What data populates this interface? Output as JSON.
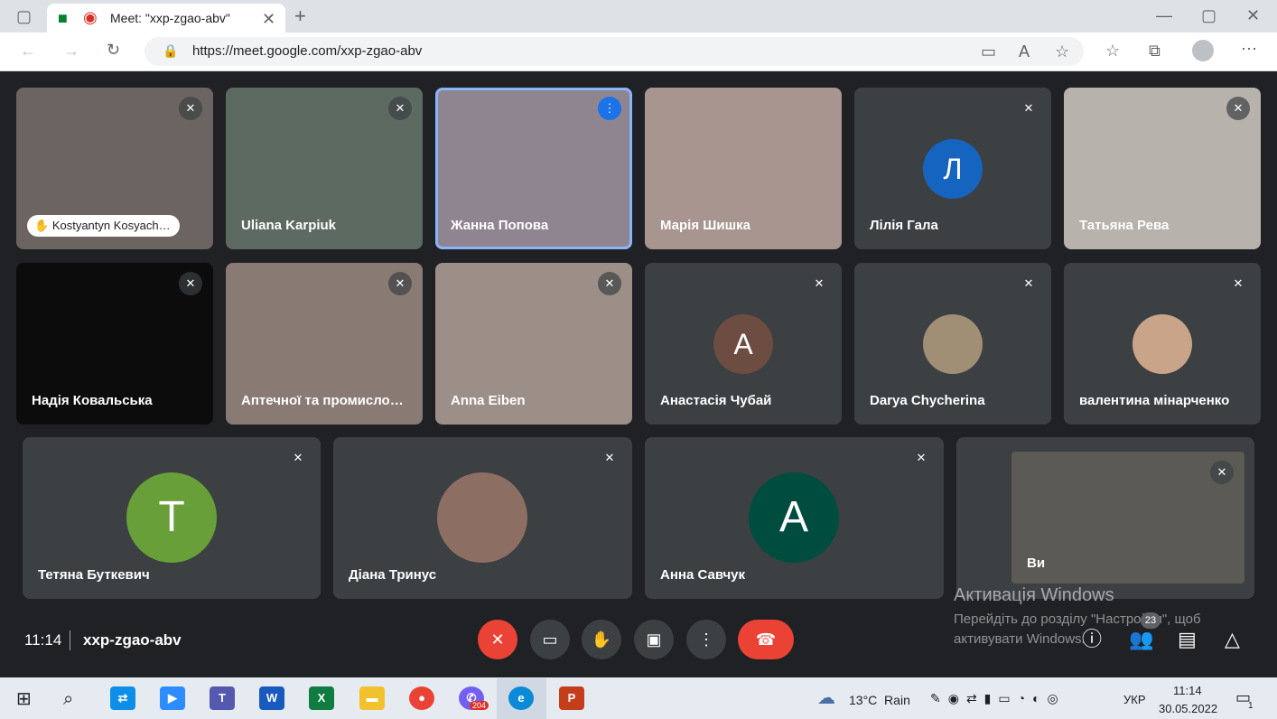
{
  "browser": {
    "tab_title": "Meet: \"xxp-zgao-abv\"",
    "url": "https://meet.google.com/xxp-zgao-abv"
  },
  "participants": [
    {
      "name": "Kostyantyn Kosyach…"
    },
    {
      "name": "Uliana Karpiuk"
    },
    {
      "name": "Жанна Попова"
    },
    {
      "name": "Марія Шишка"
    },
    {
      "name": "Лілія Гала",
      "initial": "Л"
    },
    {
      "name": "Татьяна Рева"
    },
    {
      "name": "Надія Ковальська"
    },
    {
      "name": "Аптечної та промисло…"
    },
    {
      "name": "Anna Eiben"
    },
    {
      "name": "Анастасія Чубай",
      "initial": "А"
    },
    {
      "name": "Darya Chycherina"
    },
    {
      "name": "валентина мінарченко"
    },
    {
      "name": "Тетяна Буткевич",
      "initial": "Т"
    },
    {
      "name": "Діана Тринус"
    },
    {
      "name": "Анна Савчук",
      "initial": "А"
    },
    {
      "name": "Ви"
    }
  ],
  "meeting": {
    "time": "11:14",
    "code": "xxp-zgao-abv",
    "people_count": "23"
  },
  "activation": {
    "title": "Активація Windows",
    "line1": "Перейдіть до розділу \"Настройки\", щоб",
    "line2": "активувати Windows."
  },
  "taskbar": {
    "weather": "13°C  Rain",
    "lang": "УКР",
    "clock_time": "11:14",
    "clock_date": "30.05.2022",
    "viber_badge": "204",
    "notif_count": "1"
  }
}
